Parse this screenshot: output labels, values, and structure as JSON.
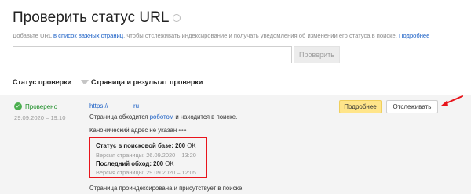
{
  "header": {
    "title": "Проверить статус URL",
    "subtitle_before": "Добавьте URL ",
    "subtitle_link": "в список важных страниц",
    "subtitle_after": ", чтобы отслеживать индексирование и получать уведомления об изменении его статуса в поиске. ",
    "more_link": "Подробнее"
  },
  "form": {
    "url_value": "",
    "check_label": "Проверить"
  },
  "table": {
    "col_status": "Статус проверки",
    "col_result": "Страница и результат проверки"
  },
  "row": {
    "status_label": "Проверено",
    "status_date": "29.09.2020 – 19:10",
    "url_prefix": "https://",
    "url_suffix": "ru",
    "text_crawled_before": "Страница обходится ",
    "text_crawled_link": "роботом",
    "text_crawled_after": " и находится в поиске.",
    "canonical_text": "Канонический адрес не указан",
    "canonical_more": "•••",
    "search_status_label": "Статус в поисковой базе:",
    "search_status_value": "200",
    "search_status_ok": "OK",
    "search_version": "Версия страницы: 26.09.2020 – 13:20",
    "last_crawl_label": "Последний обход:",
    "last_crawl_value": "200",
    "last_crawl_ok": "OK",
    "last_crawl_version": "Версия страницы: 29.09.2020 – 12:05",
    "indexed_text": "Страница проиндексирована и присутствует в поиске.",
    "details_label": "Подробнее",
    "track_label": "Отслеживать"
  },
  "icons": {
    "info": "info-icon",
    "check": "check-icon",
    "filter": "filter-icon",
    "arrow": "arrow-icon"
  },
  "colors": {
    "link": "#1a5fc5",
    "status_ok": "#1f8f2a",
    "highlight_border": "#e8141b",
    "details_button": "#ffe58a",
    "row_background": "#f4f4f4"
  }
}
